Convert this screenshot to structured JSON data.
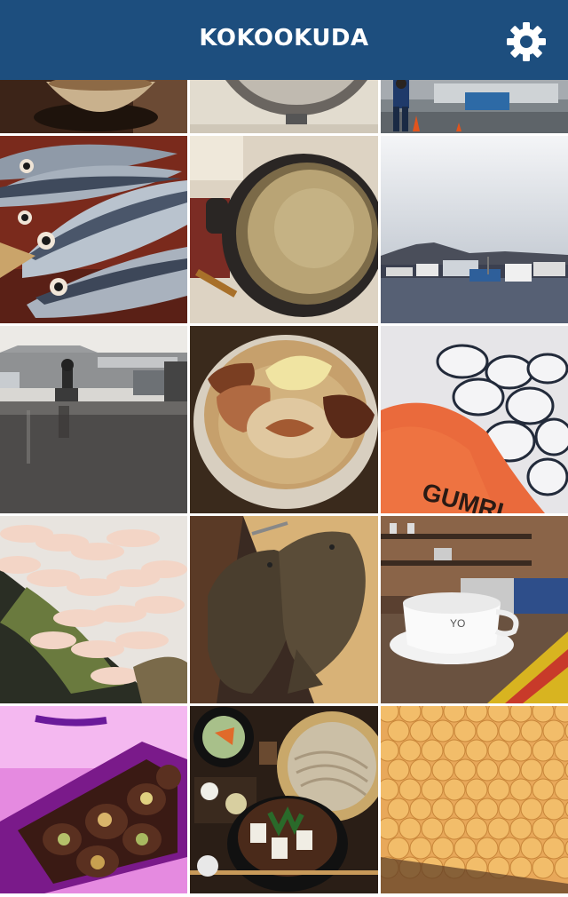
{
  "header": {
    "title": "KOKOOKUDA",
    "background": "#1d4e7e",
    "settings_icon": "gear-icon"
  },
  "photos": [
    {
      "name": "photo-bowl-top"
    },
    {
      "name": "photo-pot-top"
    },
    {
      "name": "photo-market-worker-top"
    },
    {
      "name": "photo-fresh-fish"
    },
    {
      "name": "photo-soup-pot"
    },
    {
      "name": "photo-harbor-boats"
    },
    {
      "name": "photo-rainy-fish-market"
    },
    {
      "name": "photo-ramen-bowl"
    },
    {
      "name": "photo-mochi-sweets",
      "text": "GUMRI"
    },
    {
      "name": "photo-raw-shrimp"
    },
    {
      "name": "photo-flounder"
    },
    {
      "name": "photo-coffee-cup",
      "text": "YO"
    },
    {
      "name": "photo-chocolate-box"
    },
    {
      "name": "photo-soba-set"
    },
    {
      "name": "photo-apricots"
    }
  ]
}
